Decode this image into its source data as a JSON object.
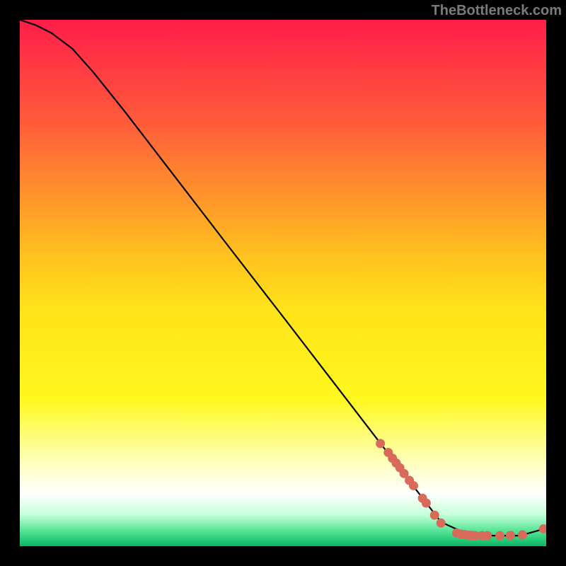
{
  "watermark": "TheBottleneck.com",
  "chart_data": {
    "type": "line",
    "title": "",
    "xlabel": "",
    "ylabel": "",
    "xlim": [
      0,
      100
    ],
    "ylim": [
      0,
      100
    ],
    "grid": false,
    "background_gradient": {
      "stops": [
        {
          "pct": 0,
          "color": "#ff1d49"
        },
        {
          "pct": 20,
          "color": "#ff5e3a"
        },
        {
          "pct": 45,
          "color": "#ffc21f"
        },
        {
          "pct": 55,
          "color": "#ffe31a"
        },
        {
          "pct": 72,
          "color": "#fff81e"
        },
        {
          "pct": 84,
          "color": "#feffbb"
        },
        {
          "pct": 90,
          "color": "#ffffff"
        },
        {
          "pct": 94,
          "color": "#c7ffda"
        },
        {
          "pct": 97,
          "color": "#58e598"
        },
        {
          "pct": 100,
          "color": "#08b860"
        }
      ]
    },
    "series": [
      {
        "name": "curve",
        "style": "line",
        "color": "#000000",
        "x": [
          0,
          3,
          6,
          10,
          14,
          20,
          30,
          40,
          50,
          60,
          70,
          78,
          80,
          85,
          90,
          95,
          100
        ],
        "y": [
          100,
          99,
          97.5,
          94.5,
          90,
          82.5,
          69.5,
          56.5,
          43.6,
          30.6,
          17.6,
          7.2,
          4.6,
          2.3,
          2.0,
          2.0,
          3.4
        ]
      },
      {
        "name": "highlight-points",
        "style": "scatter",
        "color": "#d86a5a",
        "marker": "circle",
        "x": [
          68.5,
          70.0,
          70.8,
          71.5,
          72.2,
          73.0,
          74.0,
          74.8,
          76.5,
          77.2,
          78.8,
          80.0,
          83.0,
          83.8,
          84.5,
          85.2,
          85.8,
          86.5,
          87.8,
          88.8,
          91.2,
          93.2,
          95.5,
          99.5
        ],
        "y": [
          19.5,
          17.8,
          16.7,
          15.8,
          14.9,
          13.8,
          12.5,
          11.5,
          9.1,
          8.2,
          5.9,
          4.4,
          2.5,
          2.3,
          2.2,
          2.1,
          2.05,
          2.0,
          2.0,
          2.0,
          2.0,
          2.05,
          2.15,
          3.3
        ]
      }
    ]
  }
}
